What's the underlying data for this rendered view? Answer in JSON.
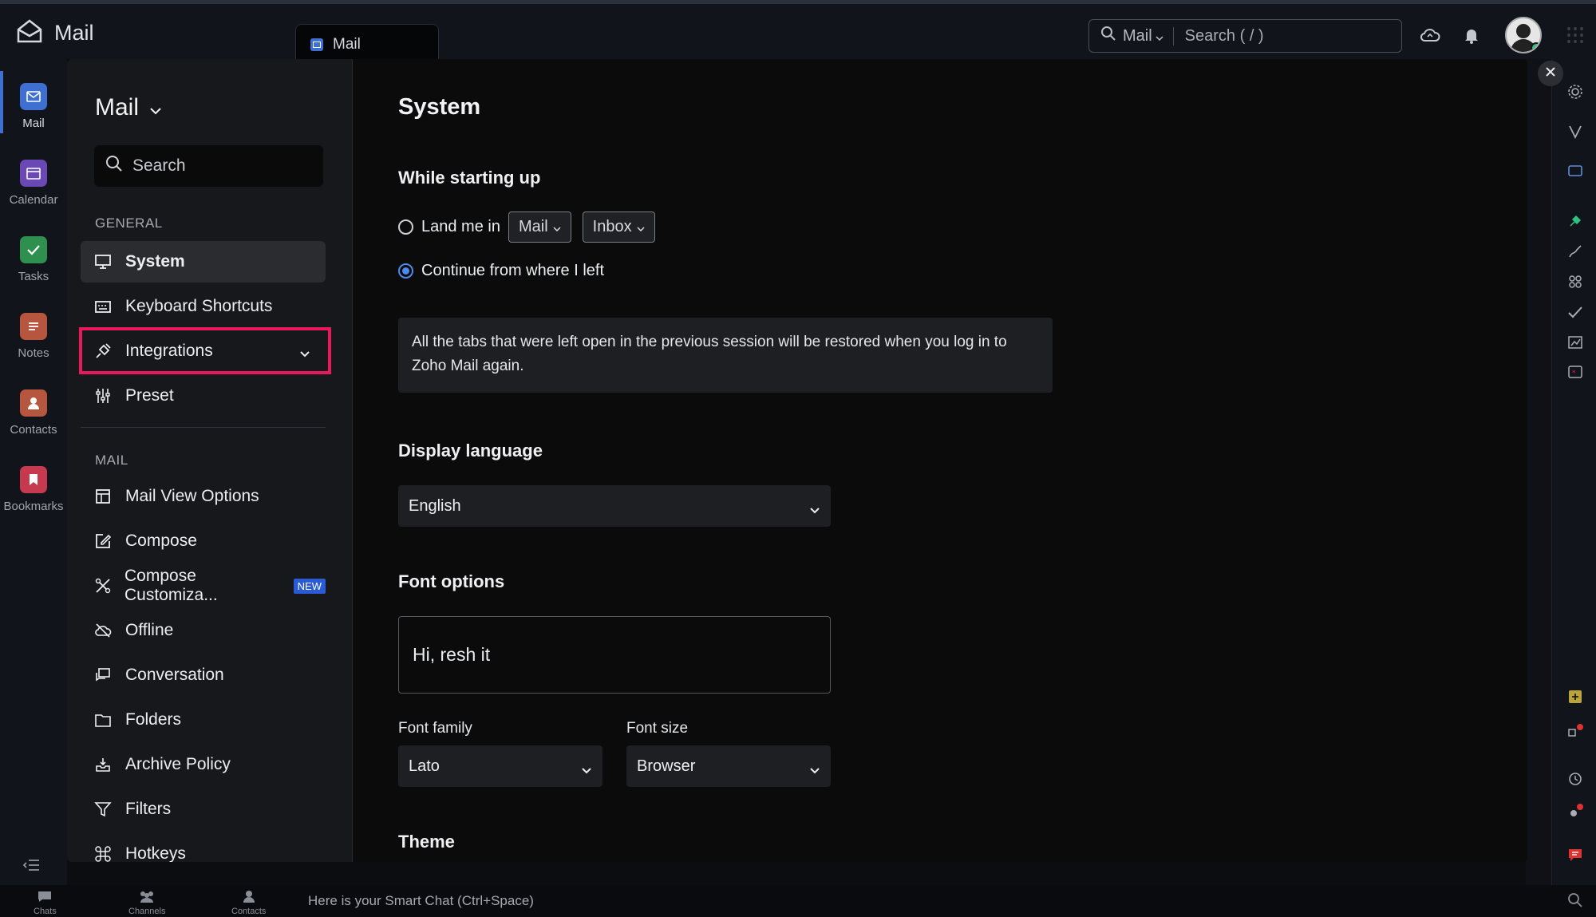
{
  "topbar": {
    "app_name": "Mail",
    "tab_label": "Mail",
    "search_scope": "Mail",
    "search_placeholder": "Search ( / )"
  },
  "left_rail": {
    "items": [
      {
        "label": "Mail",
        "icon": "mail-icon",
        "color": "#3f6fd1"
      },
      {
        "label": "Calendar",
        "icon": "calendar-icon",
        "color": "#6b49b5"
      },
      {
        "label": "Tasks",
        "icon": "tasks-icon",
        "color": "#2f8f4e"
      },
      {
        "label": "Notes",
        "icon": "notes-icon",
        "color": "#b7563e"
      },
      {
        "label": "Contacts",
        "icon": "contacts-icon",
        "color": "#b7563e"
      },
      {
        "label": "Bookmarks",
        "icon": "bookmarks-icon",
        "color": "#c53a4e"
      }
    ]
  },
  "bottom_bar": {
    "items": [
      {
        "label": "Chats",
        "icon": "chats-icon"
      },
      {
        "label": "Channels",
        "icon": "channels-icon"
      },
      {
        "label": "Contacts",
        "icon": "contacts-icon"
      }
    ],
    "smart_chat_text": "Here is your Smart Chat (Ctrl+Space)"
  },
  "settings_sidebar": {
    "title": "Mail",
    "search_placeholder": "Search",
    "general_heading": "GENERAL",
    "general_items": [
      {
        "label": "System",
        "icon": "monitor-icon",
        "active": true
      },
      {
        "label": "Keyboard Shortcuts",
        "icon": "keyboard-icon"
      },
      {
        "label": "Integrations",
        "icon": "plug-icon",
        "highlighted": true
      },
      {
        "label": "Preset",
        "icon": "sliders-icon"
      }
    ],
    "mail_heading": "MAIL",
    "mail_items": [
      {
        "label": "Mail View Options",
        "icon": "layout-icon"
      },
      {
        "label": "Compose",
        "icon": "edit-icon"
      },
      {
        "label": "Compose Customiza...",
        "icon": "tools-icon",
        "badge": "NEW"
      },
      {
        "label": "Offline",
        "icon": "cloud-off-icon"
      },
      {
        "label": "Conversation",
        "icon": "conversation-icon"
      },
      {
        "label": "Folders",
        "icon": "folder-icon"
      },
      {
        "label": "Archive Policy",
        "icon": "archive-icon"
      },
      {
        "label": "Filters",
        "icon": "filter-icon"
      },
      {
        "label": "Hotkeys",
        "icon": "command-icon"
      }
    ]
  },
  "content": {
    "title": "System",
    "startup": {
      "heading": "While starting up",
      "option_land": "Land me in",
      "land_app": "Mail",
      "land_folder": "Inbox",
      "option_continue": "Continue from where I left",
      "selected": "continue",
      "info": "All the tabs that were left open in the previous session will be restored when you log in to Zoho Mail again."
    },
    "language": {
      "heading": "Display language",
      "value": "English"
    },
    "font": {
      "heading": "Font options",
      "preview": "Hi, resh it",
      "family_label": "Font family",
      "family_value": "Lato",
      "size_label": "Font size",
      "size_value": "Browser"
    },
    "theme": {
      "heading": "Theme"
    }
  },
  "colors": {
    "accent": "#3f6fd1",
    "highlight": "#e8185d",
    "radio_selected": "#4d8af0"
  }
}
